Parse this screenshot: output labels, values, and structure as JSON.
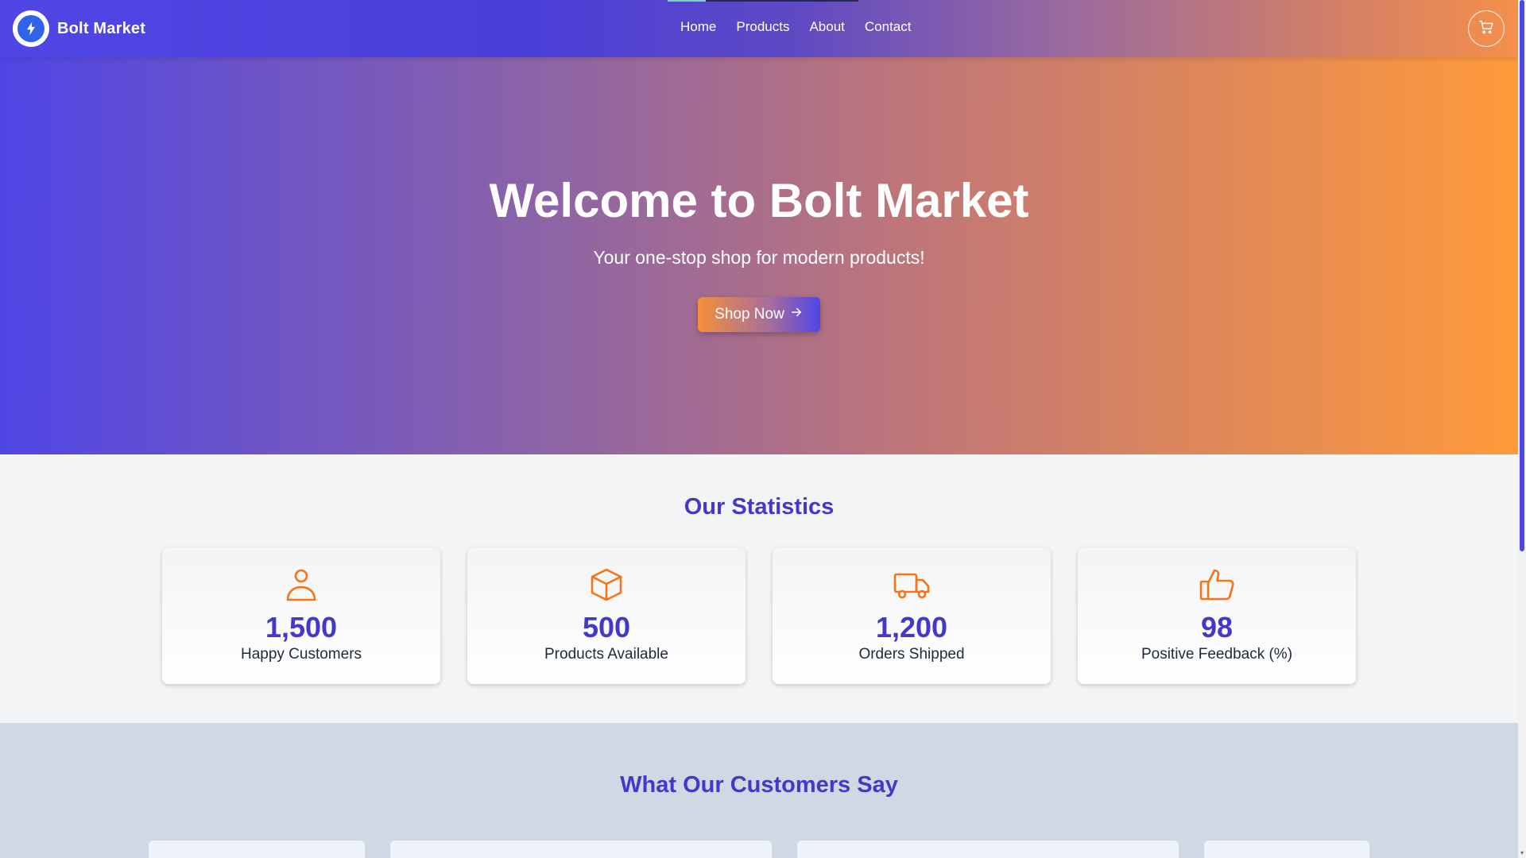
{
  "header": {
    "brand_name": "Bolt Market",
    "nav": [
      {
        "label": "Home"
      },
      {
        "label": "Products"
      },
      {
        "label": "About"
      },
      {
        "label": "Contact"
      }
    ],
    "cart_icon": "cart-icon",
    "logo_icon": "bolt-icon"
  },
  "hero": {
    "title": "Welcome to Bolt Market",
    "subtitle": "Your one-stop shop for modern products!",
    "cta_label": "Shop Now",
    "cta_icon": "arrow-right-icon"
  },
  "stats": {
    "title": "Our Statistics",
    "items": [
      {
        "value": "1,500",
        "label": "Happy Customers",
        "icon": "user-icon"
      },
      {
        "value": "500",
        "label": "Products Available",
        "icon": "box-icon"
      },
      {
        "value": "1,200",
        "label": "Orders Shipped",
        "icon": "truck-icon"
      },
      {
        "value": "98",
        "label": "Positive Feedback (%)",
        "icon": "thumbs-up-icon"
      }
    ]
  },
  "testimonials": {
    "title": "What Our Customers Say"
  },
  "colors": {
    "primary": "#4f46e5",
    "heading": "#4338ca",
    "accent": "#f97316",
    "gradient_end": "#ff9a3a"
  }
}
